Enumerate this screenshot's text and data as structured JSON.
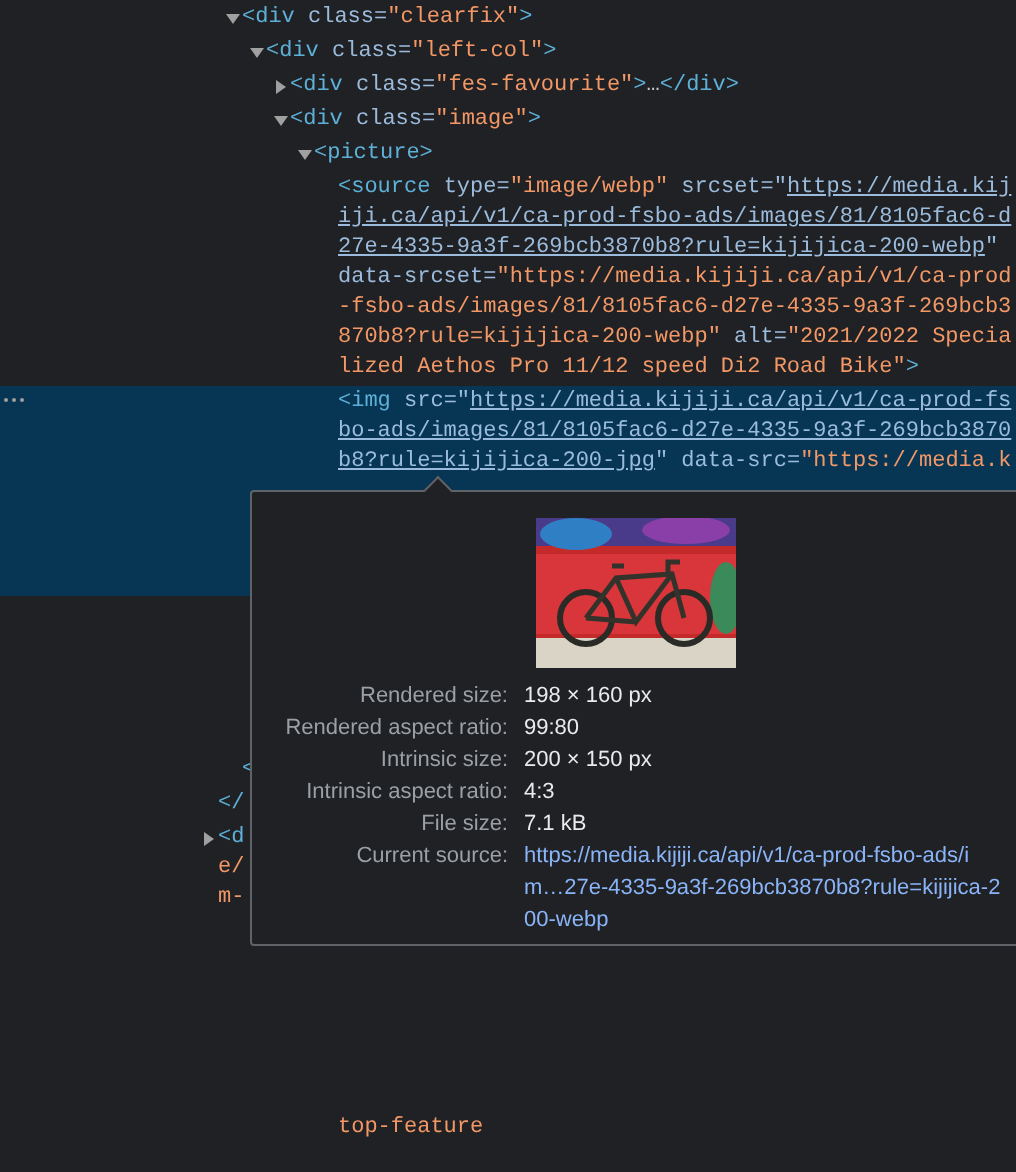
{
  "elements_tree": [
    {
      "expanded": true,
      "selected": false,
      "lines": [
        [
          {
            "kind": "tag",
            "text": "<div"
          },
          {
            "kind": "attr",
            "text": " class"
          },
          {
            "kind": "attr",
            "text": "="
          },
          {
            "kind": "value",
            "text": "\"clearfix\""
          },
          {
            "kind": "tag",
            "text": ">"
          }
        ]
      ],
      "children": [
        {
          "expanded": true,
          "selected": false,
          "lines": [
            [
              {
                "kind": "tag",
                "text": "<div"
              },
              {
                "kind": "attr",
                "text": " class"
              },
              {
                "kind": "attr",
                "text": "="
              },
              {
                "kind": "value",
                "text": "\"left-col\""
              },
              {
                "kind": "tag",
                "text": ">"
              }
            ]
          ],
          "children": [
            {
              "expanded": false,
              "selected": false,
              "lines": [
                [
                  {
                    "kind": "tag",
                    "text": "<div"
                  },
                  {
                    "kind": "attr",
                    "text": " class"
                  },
                  {
                    "kind": "attr",
                    "text": "="
                  },
                  {
                    "kind": "value",
                    "text": "\"fes-favourite\""
                  },
                  {
                    "kind": "tag",
                    "text": ">"
                  },
                  {
                    "kind": "text",
                    "text": "…"
                  },
                  {
                    "kind": "tag",
                    "text": "</div>"
                  }
                ]
              ]
            },
            {
              "expanded": true,
              "selected": false,
              "lines": [
                [
                  {
                    "kind": "tag",
                    "text": "<div"
                  },
                  {
                    "kind": "attr",
                    "text": " class"
                  },
                  {
                    "kind": "attr",
                    "text": "="
                  },
                  {
                    "kind": "value",
                    "text": "\"image\""
                  },
                  {
                    "kind": "tag",
                    "text": ">"
                  }
                ]
              ],
              "children": [
                {
                  "expanded": true,
                  "selected": false,
                  "lines": [
                    [
                      {
                        "kind": "tag",
                        "text": "<picture>"
                      }
                    ]
                  ],
                  "children": [
                    {
                      "selected": false,
                      "lines": [
                        [
                          {
                            "kind": "tag",
                            "text": "<source"
                          },
                          {
                            "kind": "attr",
                            "text": " type"
                          },
                          {
                            "kind": "attr",
                            "text": "="
                          },
                          {
                            "kind": "value",
                            "text": "\"image/webp\""
                          },
                          {
                            "kind": "attr",
                            "text": " srcset"
                          },
                          {
                            "kind": "attr",
                            "text": "=\""
                          },
                          {
                            "kind": "link",
                            "text": "https://media.kij"
                          }
                        ],
                        [
                          {
                            "kind": "link",
                            "text": "iji.ca/api/v1/ca-prod-fsbo-ads/images/81/8105fac6-d"
                          }
                        ],
                        [
                          {
                            "kind": "link",
                            "text": "27e-4335-9a3f-269bcb3870b8?rule=kijijica-200-webp"
                          },
                          {
                            "kind": "attr",
                            "text": "\""
                          }
                        ],
                        [
                          {
                            "kind": "attr",
                            "text": "data-srcset"
                          },
                          {
                            "kind": "attr",
                            "text": "="
                          },
                          {
                            "kind": "value",
                            "text": "\"https://media.kijiji.ca/api/v1/ca-prod"
                          }
                        ],
                        [
                          {
                            "kind": "value",
                            "text": "-fsbo-ads/images/81/8105fac6-d27e-4335-9a3f-269bcb3"
                          }
                        ],
                        [
                          {
                            "kind": "value",
                            "text": "870b8?rule=kijijica-200-webp\""
                          },
                          {
                            "kind": "attr",
                            "text": " alt"
                          },
                          {
                            "kind": "attr",
                            "text": "="
                          },
                          {
                            "kind": "value",
                            "text": "\"2021/2022 Specia"
                          }
                        ],
                        [
                          {
                            "kind": "value",
                            "text": "lized Aethos Pro 11/12 speed Di2 Road Bike\""
                          },
                          {
                            "kind": "tag",
                            "text": ">"
                          }
                        ]
                      ]
                    },
                    {
                      "selected": true,
                      "lines": [
                        [
                          {
                            "kind": "tag",
                            "text": "<img"
                          },
                          {
                            "kind": "attr",
                            "text": " src"
                          },
                          {
                            "kind": "attr",
                            "text": "=\""
                          },
                          {
                            "kind": "link",
                            "text": "https://media.kijiji.ca/api/v1/ca-prod-fs"
                          }
                        ],
                        [
                          {
                            "kind": "link",
                            "text": "bo-ads/images/81/8105fac6-d27e-4335-9a3f-269bcb3870"
                          }
                        ],
                        [
                          {
                            "kind": "link",
                            "text": "b8?rule=kijijica-200-jpg"
                          },
                          {
                            "kind": "attr",
                            "text": "\""
                          },
                          {
                            "kind": "attr",
                            "text": " data-src"
                          },
                          {
                            "kind": "attr",
                            "text": "="
                          },
                          {
                            "kind": "value",
                            "text": "\"https://media.k"
                          }
                        ]
                      ]
                    }
                  ]
                }
              ]
            }
          ]
        }
      ]
    }
  ],
  "lower_lines": [
    {
      "nested": true,
      "lines": [
        [
          {
            "kind": "tag",
            "text": "<"
          }
        ]
      ]
    },
    {
      "nested": false,
      "lines": [
        [
          {
            "kind": "tag",
            "text": "</"
          }
        ]
      ]
    },
    {
      "nested": false,
      "expanded": false,
      "lines": [
        [
          {
            "kind": "tag",
            "text": "<d"
          }
        ],
        [
          {
            "kind": "value",
            "text": "e/"
          }
        ],
        [
          {
            "kind": "value",
            "text": "m-"
          }
        ]
      ]
    }
  ],
  "trailing_text": [
    {
      "kind": "value",
      "text": "top-feature"
    }
  ],
  "image_tooltip": {
    "rows": [
      {
        "label": "Rendered size:",
        "value": "198 × 160 px",
        "kind": "text"
      },
      {
        "label": "Rendered aspect ratio:",
        "value": "99:80",
        "kind": "text"
      },
      {
        "label": "Intrinsic size:",
        "value": "200 × 150 px",
        "kind": "text"
      },
      {
        "label": "Intrinsic aspect ratio:",
        "value": "4:3",
        "kind": "text"
      },
      {
        "label": "File size:",
        "value": "7.1 kB",
        "kind": "text"
      },
      {
        "label": "Current source:",
        "value": "https://media.kijiji.ca/api/v1/ca-prod-fsbo-ads/im…27e-4335-9a3f-269bcb3870b8?rule=kijijica-200-webp",
        "kind": "link"
      }
    ]
  }
}
